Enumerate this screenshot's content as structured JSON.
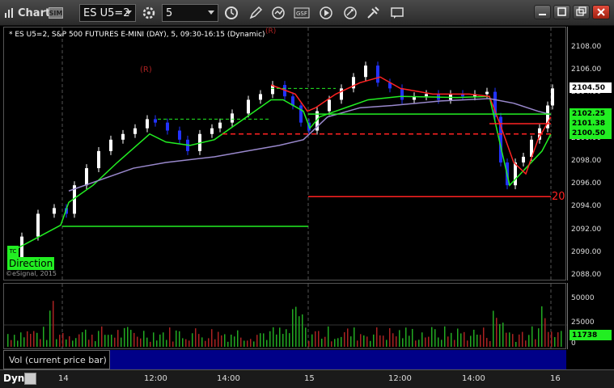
{
  "window": {
    "title": "Chart",
    "badge": "SIM",
    "symbol": "ES U5=2",
    "interval": "5"
  },
  "toolbar_icons": [
    "settings-icon",
    "clock-icon",
    "pencil-icon",
    "refresh-icon",
    "gsf-icon",
    "play-icon",
    "link-icon",
    "chat-icon"
  ],
  "chart": {
    "title": "* ES U5=2, S&P 500 FUTURES E-MINI (DAY), 5, 09:30-16:15 (Dynamic)",
    "r_marker_top": "(R)",
    "r_marker_left": "(R)",
    "label_20": "20",
    "direction_label": "Direction",
    "copyright": "©eSignal, 2015",
    "bubble_label": "TC"
  },
  "price_axis": {
    "ticks": [
      "2108.00",
      "2106.00",
      "2104.00",
      "2102.00",
      "2100.00",
      "2098.00",
      "2096.00",
      "2094.00",
      "2092.00",
      "2090.00",
      "2088.00"
    ],
    "tags": [
      {
        "value": "2104.50",
        "bg": "#ffffff",
        "fg": "#000000"
      },
      {
        "value": "2102.25",
        "bg": "#22ee22",
        "fg": "#000000"
      },
      {
        "value": "2101.38",
        "bg": "#22ee22",
        "fg": "#000000"
      },
      {
        "value": "2100.50",
        "bg": "#22ee22",
        "fg": "#000000"
      }
    ]
  },
  "volume": {
    "label": "Vol (current price bar)",
    "ticks": [
      "50000",
      "25000",
      "0"
    ],
    "current_tag": "11738"
  },
  "time_axis": {
    "dyn_label": "Dyn",
    "labels": [
      "14",
      "12:00",
      "14:00",
      "15",
      "12:00",
      "14:00",
      "16"
    ]
  },
  "colors": {
    "up_candle": "#ffffff",
    "down_candle": "#2233ff",
    "green_line": "#22ee22",
    "red_line": "#ff2222",
    "purple_line": "#9988cc",
    "vol_green": "#22aa22",
    "vol_red": "#aa2222"
  }
}
